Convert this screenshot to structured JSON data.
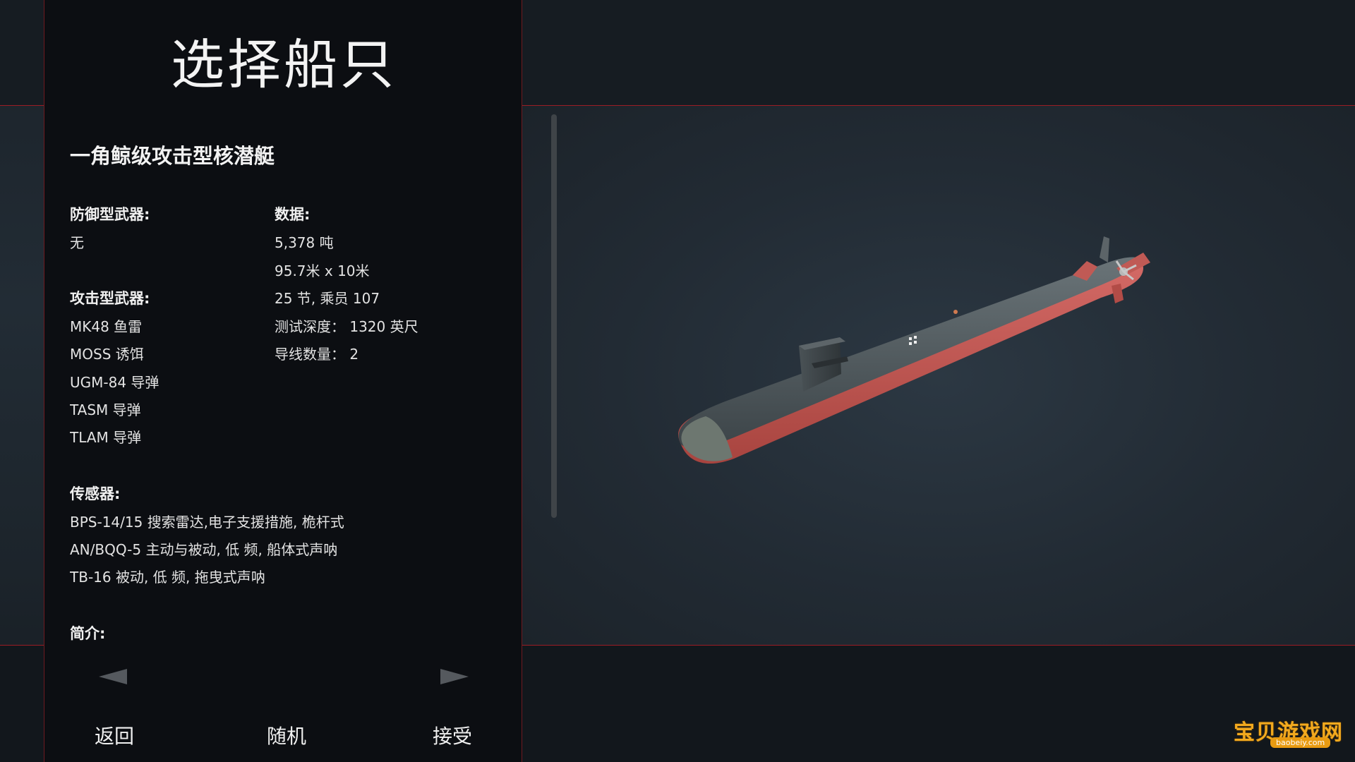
{
  "screen": {
    "title": "选择船只"
  },
  "ship": {
    "name": "一角鲸级攻击型核潜艇",
    "defense_label": "防御型武器:",
    "defense_items": [
      "无"
    ],
    "data_label": "数据:",
    "data_items": [
      "5,378 吨",
      "95.7米 x 10米",
      "25 节, 乘员 107",
      "测试深度：  1320 英尺",
      "导线数量：  2"
    ],
    "attack_label": "攻击型武器:",
    "attack_items": [
      "MK48 鱼雷",
      "MOSS 诱饵",
      "UGM-84 导弹",
      "TASM 导弹",
      "TLAM 导弹"
    ],
    "sensor_label": "传感器:",
    "sensor_items": [
      "BPS-14/15 搜索雷达,电子支援措施, 桅杆式",
      "AN/BQQ-5 主动与被动, 低 频, 船体式声呐",
      "TB-16  被动, 低 频, 拖曳式声呐"
    ],
    "intro_label": "简介:"
  },
  "controls": {
    "back_label": "返回",
    "random_label": "随机",
    "accept_label": "接受",
    "prev_icon": "arrow-left-icon",
    "next_icon": "arrow-right-icon"
  },
  "watermark": {
    "text": "宝贝游戏网",
    "url": "baobeiy.com"
  },
  "colors": {
    "accent_red": "#9b1d25",
    "panel_bg": "#0c0e12",
    "watermark_orange": "#f2a91e"
  }
}
